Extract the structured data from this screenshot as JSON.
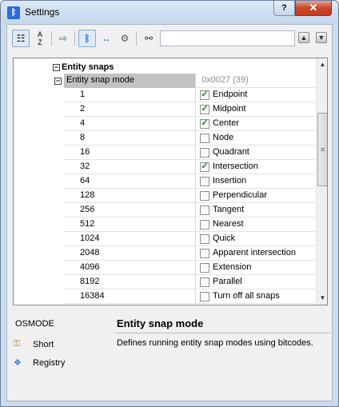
{
  "window": {
    "title": "Settings",
    "help_label": "?",
    "close_label": "✕"
  },
  "toolbar": {
    "search_value": "",
    "buttons": [
      "categorized-view",
      "alphabetical-view",
      "export",
      "show-app-settings",
      "show-fixed-width",
      "show-options"
    ]
  },
  "grid": {
    "category": "Entity snaps",
    "property": {
      "name": "Entity snap mode",
      "value": "0x0027 (39)"
    },
    "rows": [
      {
        "bit": "1",
        "label": "Endpoint",
        "checked": true
      },
      {
        "bit": "2",
        "label": "Midpoint",
        "checked": true
      },
      {
        "bit": "4",
        "label": "Center",
        "checked": true
      },
      {
        "bit": "8",
        "label": "Node",
        "checked": false
      },
      {
        "bit": "16",
        "label": "Quadrant",
        "checked": false
      },
      {
        "bit": "32",
        "label": "Intersection",
        "checked": true
      },
      {
        "bit": "64",
        "label": "Insertion",
        "checked": false
      },
      {
        "bit": "128",
        "label": "Perpendicular",
        "checked": false
      },
      {
        "bit": "256",
        "label": "Tangent",
        "checked": false
      },
      {
        "bit": "512",
        "label": "Nearest",
        "checked": false
      },
      {
        "bit": "1024",
        "label": "Quick",
        "checked": false
      },
      {
        "bit": "2048",
        "label": "Apparent intersection",
        "checked": false
      },
      {
        "bit": "4096",
        "label": "Extension",
        "checked": false
      },
      {
        "bit": "8192",
        "label": "Parallel",
        "checked": false
      },
      {
        "bit": "16384",
        "label": "Turn off all snaps",
        "checked": false
      }
    ]
  },
  "info": {
    "variable": "OSMODE",
    "short_label": "Short",
    "registry_label": "Registry",
    "title": "Entity snap mode",
    "description": "Defines running entity snap modes using bitcodes."
  }
}
